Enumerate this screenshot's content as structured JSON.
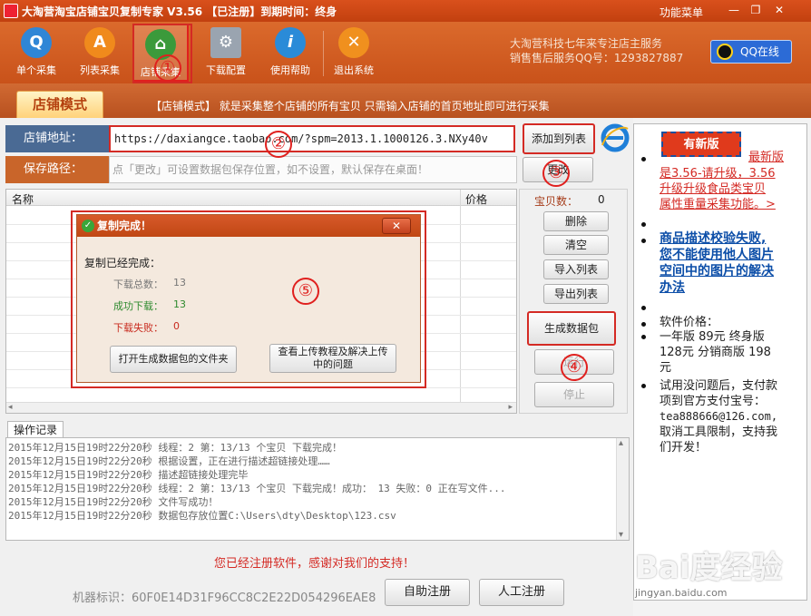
{
  "titlebar": {
    "title": "大淘营淘宝店铺宝贝复制专家 V3.56 【已注册】到期时间：终身",
    "menu_label": "功能菜单",
    "minimize": "—",
    "restore": "❐",
    "close": "✕"
  },
  "toolbar": {
    "items": [
      {
        "label": "单个采集",
        "icon": "Q",
        "color": "#2f86d6"
      },
      {
        "label": "列表采集",
        "icon": "A",
        "color": "#f08a1c"
      },
      {
        "label": "店铺采集",
        "icon": "⌂",
        "color": "#3b9a3b"
      },
      {
        "label": "下载配置",
        "icon": "⚙",
        "color": "#9aa4b0"
      },
      {
        "label": "使用帮助",
        "icon": "i",
        "color": "#2a8bd8"
      },
      {
        "label": "退出系统",
        "icon": "✕",
        "color": "#f0901e"
      }
    ],
    "active_index": 2,
    "info_line1": "大淘营科技七年来专注店主服务",
    "info_line2": "销售售后服务QQ号：1293827887",
    "qq_button": "QQ在线"
  },
  "modebar": {
    "tab": "店铺模式",
    "description": "【店铺模式】 就是采集整个店铺的所有宝贝 只需输入店铺的首页地址即可进行采集"
  },
  "form": {
    "shop_label": "店铺地址：",
    "shop_url": "https://daxiangce.taobao.com/?spm=2013.1.1000126.3.NXy40v",
    "add_button": "添加到列表",
    "path_label": "保存路径：",
    "path_placeholder": "点「更改」可设置数据包保存位置，如不设置，默认保存在桌面！",
    "change_button": "更改"
  },
  "grid": {
    "col_name": "名称",
    "col_price": "价格",
    "scroll_left": "◂",
    "scroll_right": "▸"
  },
  "side": {
    "count_label": "宝贝数：",
    "count_value": "0",
    "delete": "删除",
    "clear": "清空",
    "import": "导入列表",
    "export": "导出列表",
    "generate": "生成数据包",
    "start": "运行",
    "stop": "停止"
  },
  "dialog": {
    "title": "复制完成！",
    "close": "✕",
    "heading": "复制已经完成：",
    "total_label": "下载总数：",
    "total_value": "13",
    "success_label": "成功下载：",
    "success_value": "13",
    "fail_label": "下载失败：",
    "fail_value": "0",
    "open_folder": "打开生成数据包的文件夹",
    "view_tutorial_line1": "查看上传教程及解决上传",
    "view_tutorial_line2": "中的问题"
  },
  "log": {
    "tab": "操作记录",
    "lines": [
      "2015年12月15日19时22分20秒 线程：2 第：13/13 个宝贝 下载完成！",
      "2015年12月15日19时22分20秒  根据设置，正在进行描述超链接处理……",
      "2015年12月15日19时22分20秒  描述超链接处理完毕",
      "2015年12月15日19时22分20秒  线程：2 第：13/13 个宝贝 下载完成！成功： 13 失败：0 正在写文件...",
      "2015年12月15日19时22分20秒 文件写成功！",
      "2015年12月15日19时22分20秒 数据包存放位置C:\\Users\\dty\\Desktop\\123.csv"
    ],
    "scroll_up": "▴",
    "scroll_down": "▾"
  },
  "footer": {
    "registered_msg": "您已经注册软件，感谢对我们的支持！",
    "machine_label": "机器标识：60F0E14D31F96CC8C2E22D054296EAE8",
    "self_register": "自助注册",
    "manual_register": "人工注册"
  },
  "right": {
    "new_badge": "有新版",
    "new_text_1": "最新版",
    "new_text_2": "是3.56-请升级，3.56",
    "new_text_3": "升级升级食品类宝贝",
    "new_text_4": "属性重量采集功能。>",
    "fix_1": "商品描述校验失败,",
    "fix_2": "您不能使用他人图片",
    "fix_3": "空间中的图片的解决",
    "fix_4": "办法",
    "price_title": "软件价格：",
    "price_1": "一年版 89元 终身版",
    "price_2": "128元 分销商版 198",
    "price_3": "元",
    "pay_1": "试用没问题后，支付款",
    "pay_2": "项到官方支付宝号：",
    "pay_3": "tea888666@126.com,",
    "pay_4": "取消工具限制，支持我",
    "pay_5": "们开发！"
  },
  "annotations": [
    "①",
    "②",
    "③",
    "④",
    "⑤"
  ],
  "watermark": "Bai度经验",
  "watermark_sub": "jingyan.baidu.com",
  "colors": {
    "accent": "#c9521a",
    "highlight": "#d42a24",
    "label_bg": "#4a6a94"
  }
}
